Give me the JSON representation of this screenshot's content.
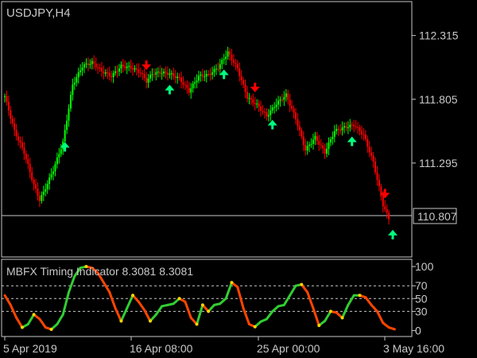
{
  "window": {
    "symbol_label": "USDJPY,H4",
    "price_marker": "110.807"
  },
  "indicator": {
    "label": "MBFX Timing Indicator 8.3081 8.3081"
  },
  "colors": {
    "background": "#000000",
    "frame": "#c8c8c8",
    "bull_candle": "#00ff00",
    "bear_candle": "#ff0000",
    "buy_arrow": "#00ff7f",
    "sell_arrow": "#ff0000",
    "indicator_up": "#32cd32",
    "indicator_down": "#ff4500",
    "indicator_turn": "#ffd700",
    "level_line": "#c8c8c8",
    "text": "#c8c8c8"
  },
  "chart_data": [
    {
      "type": "candlestick",
      "title": "USDJPY,H4",
      "y_ticks": [
        112.315,
        111.805,
        111.295
      ],
      "ylim": [
        110.55,
        112.58
      ],
      "x_ticks": [
        "5 Apr 2019",
        "16 Apr 08:00",
        "25 Apr 00:00",
        "3 May 16:00"
      ],
      "current_price": 110.807,
      "close_path": {
        "bar_index": [
          0,
          5,
          10,
          15,
          18,
          20,
          25,
          30,
          35,
          40,
          45,
          50,
          55,
          60,
          65,
          70,
          73,
          76,
          80,
          85,
          90,
          95,
          100,
          105,
          110,
          115,
          120,
          125,
          130,
          135,
          140,
          145,
          150,
          155,
          160,
          165,
          170,
          175,
          180,
          185,
          190,
          195,
          198
        ],
        "close": [
          111.83,
          111.55,
          111.38,
          111.12,
          111.0,
          111.06,
          111.24,
          111.46,
          111.92,
          112.07,
          112.1,
          112.03,
          111.99,
          112.07,
          112.06,
          112.02,
          111.95,
          112.01,
          112.02,
          112.01,
          111.97,
          111.87,
          111.99,
          112.0,
          112.06,
          112.18,
          112.05,
          111.82,
          111.76,
          111.67,
          111.77,
          111.84,
          111.65,
          111.4,
          111.5,
          111.38,
          111.55,
          111.58,
          111.6,
          111.52,
          111.3,
          110.96,
          110.85
        ]
      },
      "markers": [
        {
          "kind": "sell",
          "bar_index": 73
        },
        {
          "kind": "buy",
          "bar_index": 31
        },
        {
          "kind": "buy",
          "bar_index": 85
        },
        {
          "kind": "buy",
          "bar_index": 113
        },
        {
          "kind": "sell",
          "bar_index": 129
        },
        {
          "kind": "buy",
          "bar_index": 138
        },
        {
          "kind": "buy",
          "bar_index": 179
        },
        {
          "kind": "sell",
          "bar_index": 196
        },
        {
          "kind": "buy",
          "bar_index": 200
        }
      ]
    },
    {
      "type": "line",
      "title": "MBFX Timing Indicator 8.3081 8.3081",
      "y_ticks": [
        100,
        70,
        50,
        30,
        0
      ],
      "levels": [
        70,
        50,
        30
      ],
      "ylim": [
        -8,
        110
      ],
      "series": [
        {
          "bar_index": [
            0,
            3,
            6,
            9,
            12,
            15,
            18,
            21,
            24,
            27,
            30,
            33,
            36,
            39,
            42,
            45,
            48,
            51,
            54,
            57,
            60,
            63,
            66,
            69,
            72,
            75,
            78,
            81,
            84,
            87,
            90,
            93,
            96,
            99,
            102,
            105,
            108,
            111,
            114,
            117,
            120,
            123,
            126,
            129,
            132,
            135,
            138,
            141,
            144,
            147,
            150,
            153,
            156,
            159,
            162,
            165,
            168,
            171,
            174,
            177,
            180,
            183,
            186,
            189,
            192,
            195,
            198,
            201
          ],
          "values": [
            55,
            40,
            20,
            5,
            10,
            25,
            18,
            5,
            2,
            10,
            25,
            60,
            85,
            98,
            100,
            98,
            90,
            75,
            60,
            35,
            15,
            35,
            55,
            45,
            32,
            15,
            25,
            38,
            40,
            42,
            50,
            45,
            20,
            10,
            40,
            30,
            40,
            42,
            50,
            75,
            68,
            35,
            10,
            6,
            14,
            18,
            30,
            38,
            40,
            55,
            70,
            72,
            60,
            35,
            8,
            15,
            30,
            28,
            20,
            40,
            55,
            55,
            52,
            40,
            30,
            12,
            5,
            2
          ]
        }
      ]
    }
  ]
}
